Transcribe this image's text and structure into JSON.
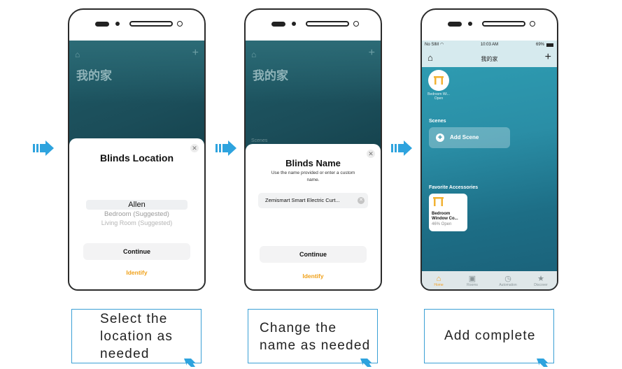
{
  "phones": [
    {
      "home_title": "我的家",
      "sheet_title": "Blinds Location",
      "picker": [
        "Allen",
        "Bedroom (Suggested)",
        "Living Room (Suggested)"
      ],
      "continue_label": "Continue",
      "identify_label": "Identify"
    },
    {
      "home_title": "我的家",
      "scenes_label": "Scenes",
      "sheet_title": "Blinds Name",
      "subtitle": "Use the name provided or enter a custom name.",
      "name_value": "Zemismart Smart Electric Curt...",
      "continue_label": "Continue",
      "identify_label": "Identify"
    },
    {
      "status_left": "No SIM",
      "status_time": "10:03 AM",
      "status_right": "69%",
      "nav_title": "我的家",
      "device_name": "Bedroom Wi...",
      "device_state": "Open",
      "scenes_label": "Scenes",
      "add_scene_label": "Add Scene",
      "favorites_label": "Favorite Accessories",
      "tile_name_1": "Bedroom",
      "tile_name_2": "Window Co...",
      "tile_status": "46% Open",
      "tabs": [
        "Home",
        "Rooms",
        "Automation",
        "Discover"
      ]
    }
  ],
  "captions": [
    [
      "Select the",
      "location as",
      "needed"
    ],
    [
      "Change the",
      "name as needed"
    ],
    [
      "Add complete"
    ]
  ],
  "colors": {
    "accent": "#3aa0d5",
    "identify": "#f0a11a",
    "tile_icon": "#f2b233"
  }
}
